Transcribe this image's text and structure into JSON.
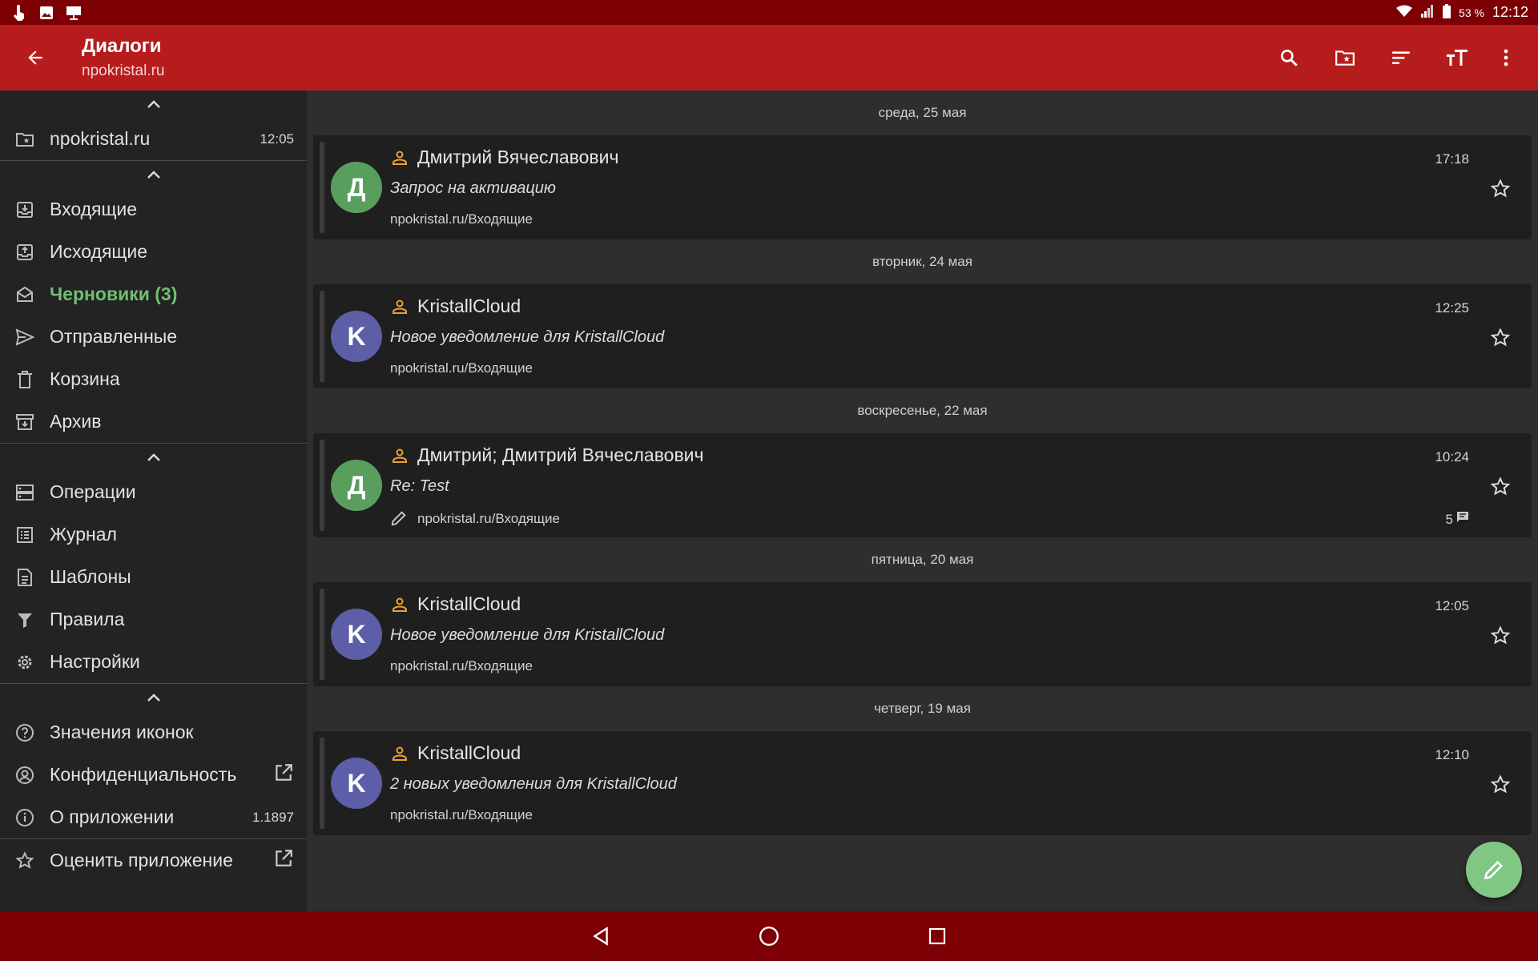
{
  "colors": {
    "statusbar": "#7c0004",
    "appbar": "#b71c1c",
    "accent_green": "#6fbf73",
    "avatar_green": "#5a9e5e",
    "avatar_purple": "#5c5ea8",
    "person_icon": "#f0a030",
    "fab": "#81c784"
  },
  "statusbar": {
    "battery": "53 %",
    "time": "12:12"
  },
  "appbar": {
    "title": "Диалоги",
    "subtitle": "npokristal.ru",
    "actions": [
      "search-icon",
      "folder-star-icon",
      "sort-icon",
      "text-size-icon",
      "more-vert-icon"
    ]
  },
  "sidebar": {
    "account": {
      "label": "npokristal.ru",
      "time": "12:05"
    },
    "folders": [
      {
        "label": "Входящие",
        "icon": "inbox-icon"
      },
      {
        "label": "Исходящие",
        "icon": "outbox-icon"
      },
      {
        "label": "Черновики (3)",
        "icon": "drafts-icon",
        "active": true
      },
      {
        "label": "Отправленные",
        "icon": "send-icon"
      },
      {
        "label": "Корзина",
        "icon": "trash-icon"
      },
      {
        "label": "Архив",
        "icon": "archive-icon"
      }
    ],
    "tools": [
      {
        "label": "Операции",
        "icon": "operations-icon"
      },
      {
        "label": "Журнал",
        "icon": "log-icon"
      },
      {
        "label": "Шаблоны",
        "icon": "templates-icon"
      },
      {
        "label": "Правила",
        "icon": "filter-icon"
      },
      {
        "label": "Настройки",
        "icon": "settings-icon"
      }
    ],
    "info": [
      {
        "label": "Значения иконок",
        "icon": "help-icon"
      },
      {
        "label": "Конфиденциальность",
        "icon": "privacy-icon",
        "external": true
      },
      {
        "label": "О приложении",
        "icon": "info-icon",
        "version": "1.1897"
      },
      {
        "label": "Оценить приложение",
        "icon": "star-icon",
        "external": true
      }
    ]
  },
  "messages": [
    {
      "date": "среда, 25 мая",
      "letter": "Д",
      "sender": "Дмитрий Вячеславович",
      "subject": "Запрос на активацию",
      "folder": "npokristal.ru/Входящие",
      "time": "17:18"
    },
    {
      "date": "вторник, 24 мая",
      "letter": "K",
      "sender": "KristallCloud",
      "subject": "Новое уведомление для KristallCloud",
      "folder": "npokristal.ru/Входящие",
      "time": "12:25"
    },
    {
      "date": "воскресенье, 22 мая",
      "letter": "Д",
      "sender": "Дмитрий; Дмитрий Вячеславович",
      "subject": "Re: Test",
      "folder": "npokristal.ru/Входящие",
      "time": "10:24",
      "count": "5"
    },
    {
      "date": "пятница, 20 мая",
      "letter": "K",
      "sender": "KristallCloud",
      "subject": "Новое уведомление для KristallCloud",
      "folder": "npokristal.ru/Входящие",
      "time": "12:05"
    },
    {
      "date": "четверг, 19 мая",
      "letter": "K",
      "sender": "KristallCloud",
      "subject": "2 новых уведомления для KristallCloud",
      "folder": "npokristal.ru/Входящие",
      "time": "12:10"
    }
  ]
}
